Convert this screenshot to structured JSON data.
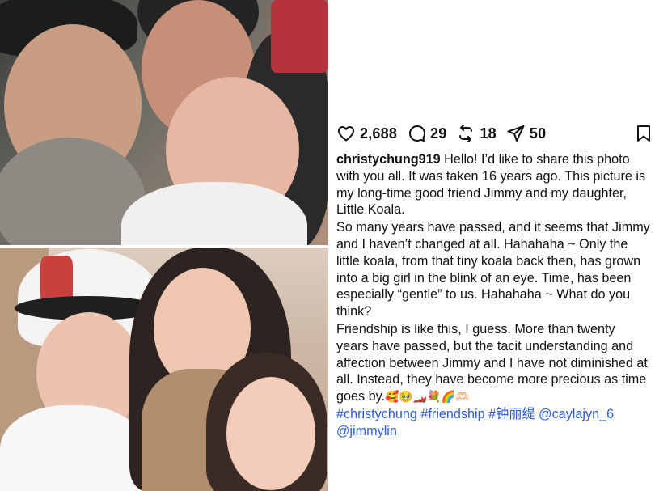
{
  "actions": {
    "likes": "2,688",
    "comments": "29",
    "reposts": "18",
    "shares": "50"
  },
  "caption": {
    "username": "christychung919",
    "paragraph1": " Hello! I’d like to share this photo with you all. It was taken 16 years ago. This picture is my long-time good friend Jimmy and my daughter, Little Koala.",
    "paragraph2": "So many years have passed, and it seems that Jimmy and I haven’t changed at all. Hahahaha ~ Only the little koala, from that tiny koala back then, has grown into a big girl in the blink of an eye. Time, has been especially “gentle” to us. Hahahaha ~ What do you think?",
    "paragraph3": "Friendship is like this, I guess. More than twenty years have passed, but the tacit understanding and affection between Jimmy and I have not diminished at all. Instead, they have become more precious as time goes by.",
    "emojis": "🥰🥹🏎️💐🌈🫶🏻",
    "hashtags": [
      "#christychung",
      "#friendship",
      "#钟丽缇",
      "@caylajyn_6",
      "@jimmylin"
    ]
  },
  "colors": {
    "link": "#2b5bd7",
    "text": "#111111"
  },
  "icons": [
    "heart-icon",
    "comment-icon",
    "repost-icon",
    "share-icon",
    "bookmark-icon"
  ]
}
